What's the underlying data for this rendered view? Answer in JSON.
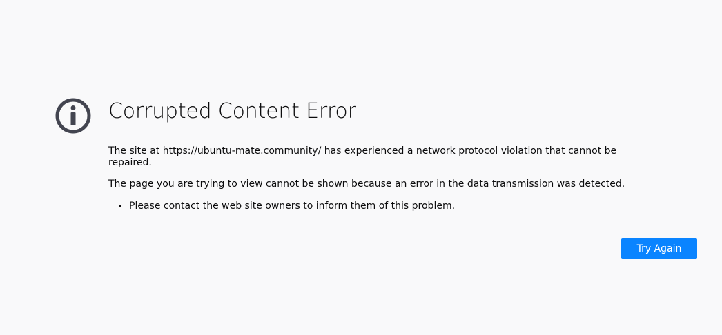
{
  "error_page": {
    "icon": "info-icon",
    "title": "Corrupted Content Error",
    "description": "The site at https://ubuntu-mate.community/ has experienced a network protocol violation that cannot be repaired.",
    "details": "The page you are trying to view cannot be shown because an error in the data transmission was detected.",
    "suggestions": [
      "Please contact the web site owners to inform them of this problem."
    ],
    "try_again_label": "Try Again"
  },
  "colors": {
    "background": "#f9f9fa",
    "icon": "#434550",
    "button": "#0a84ff",
    "button_text": "#ffffff",
    "text": "#0c0c0d"
  }
}
